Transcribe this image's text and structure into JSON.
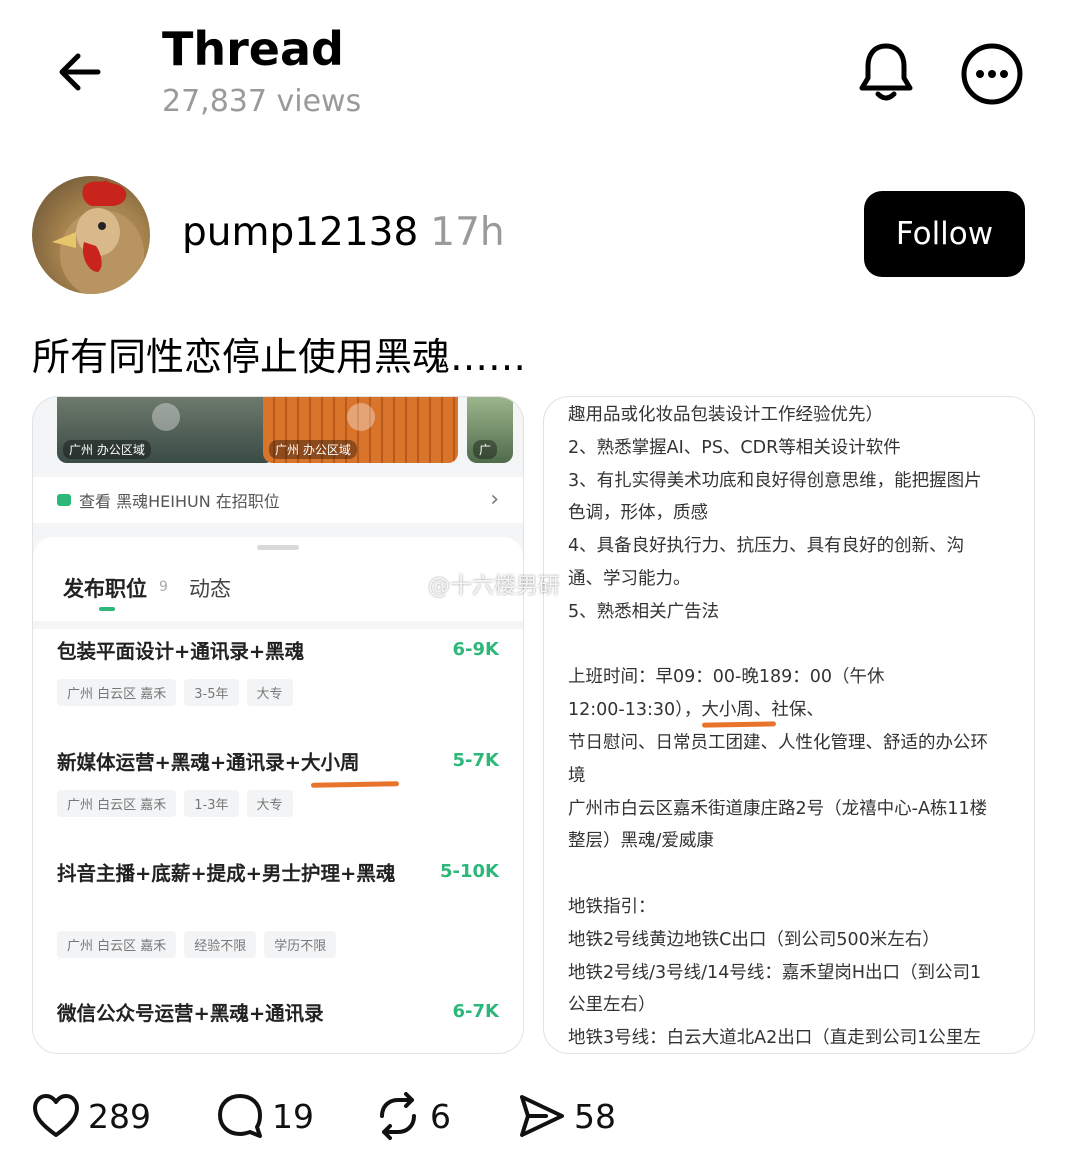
{
  "header": {
    "title": "Thread",
    "views": "27,837 views"
  },
  "post": {
    "author": "pump12138",
    "time": "17h",
    "follow_label": "Follow",
    "text": "所有同性恋停止使用黑魂……"
  },
  "left_image": {
    "office_labels": [
      "广州 办公区域",
      "广州 办公区域",
      "广"
    ],
    "hiring_link": "查看 黑魂HEIHUN 在招职位",
    "tabs": [
      {
        "label": "发布职位",
        "count": "9"
      },
      {
        "label": "动态"
      }
    ],
    "jobs": [
      {
        "title": "包装平面设计+通讯录+黑魂",
        "salary": "6-9K",
        "tags": [
          "广州 白云区 嘉禾",
          "3-5年",
          "大专"
        ]
      },
      {
        "title": "新媒体运营+黑魂+通讯录+大小周",
        "salary": "5-7K",
        "tags": [
          "广州 白云区 嘉禾",
          "1-3年",
          "大专"
        ]
      },
      {
        "title": "抖音主播+底薪+提成+男士护理+黑魂",
        "salary": "5-10K",
        "tags": [
          "广州 白云区 嘉禾",
          "经验不限",
          "学历不限"
        ]
      },
      {
        "title": "微信公众号运营+黑魂+通讯录",
        "salary": "6-7K",
        "tags": []
      }
    ]
  },
  "right_image": {
    "lines": [
      "趣用品或化妆品包装设计工作经验优先）",
      "2、熟悉掌握AI、PS、CDR等相关设计软件",
      "3、有扎实得美术功底和良好得创意思维，能把握图片",
      "色调，形体，质感",
      "4、具备良好执行力、抗压力、具有良好的创新、沟",
      "通、学习能力。",
      "5、熟悉相关广告法",
      "",
      "上班时间：早09：00-晚189：00（午休",
      "12:00-13:30），大小周、社保、",
      "节日慰问、日常员工团建、人性化管理、舒适的办公环",
      "境",
      "广州市白云区嘉禾街道康庄路2号（龙禧中心-A栋11楼",
      "整层）黑魂/爱威康",
      "",
      "地铁指引：",
      "地铁2号线黄边地铁C出口（到公司500米左右）",
      "地铁2号线/3号线/14号线：嘉禾望岗H出口（到公司1",
      "公里左右）",
      "地铁3号线：白云大道北A2出口（直走到公司1公里左"
    ],
    "watermark": "@十六楼男研"
  },
  "actions": {
    "likes": "289",
    "replies": "19",
    "reposts": "6",
    "shares": "58"
  },
  "colors": {
    "accent_green": "#2db87a",
    "muted_gray": "#9a9a9a",
    "highlight_orange": "#e8742c"
  },
  "icons": [
    "back-arrow-icon",
    "bell-icon",
    "more-icon",
    "heart-icon",
    "comment-icon",
    "repost-icon",
    "share-icon"
  ]
}
